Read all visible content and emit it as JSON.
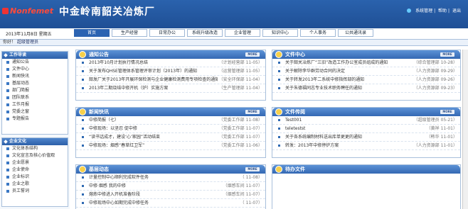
{
  "header": {
    "logo_text": "Nonfemet",
    "company": "中金岭南韶关冶炼厂",
    "links": [
      "系统管理",
      "帮助",
      "退出"
    ]
  },
  "date": "2013年11月8日  星期五",
  "nav": [
    "首页",
    "生产经营",
    "日常办公",
    "系统升级改造",
    "企业管理",
    "知识中心",
    "个人事务",
    "公共通讯录"
  ],
  "welcome": {
    "label": "你好！",
    "user": "超级管理员"
  },
  "sidebar": {
    "work": {
      "title": "工作导读",
      "items": [
        "通知公告",
        "文件中心",
        "新闻快讯",
        "基层动态",
        "部门简报",
        "团队联系",
        "工作月报",
        "党委之窗",
        "专题报告"
      ]
    },
    "culture": {
      "title": "企业文化",
      "items": [
        "文化体系结构",
        "文化宣言及核心价值观",
        "企业愿景",
        "企业使命",
        "企业标识",
        "企业之歌",
        "员工誓词"
      ]
    }
  },
  "more_label": "MORE",
  "panels": {
    "notice": {
      "title": "通知公告",
      "rows": [
        {
          "text": "2013年10月计划执行情况总结",
          "meta": "（计划经营部 11-05）"
        },
        {
          "text": "关于发布QHSE管理体系管理评审计划（2013年）的通知",
          "meta": "（运营管理部 11-05）"
        },
        {
          "text": "韶发厂关于2013年开展环保检测与企业健康检测费用专项检查的通知",
          "meta": "（安全环保部 11-04）"
        },
        {
          "text": "2013年二期烧结中修开机（炉）实施方案",
          "meta": "（生产管理部 11-04）"
        }
      ]
    },
    "files": {
      "title": "文件中心",
      "rows": [
        {
          "text": "关于韶关冶炼厂“三旧”改造工作办公室成员组成的通知",
          "meta": "（综合管理部 10-28）"
        },
        {
          "text": "关于解除李华群劳动合同的决定",
          "meta": "（人力资源部 09-29）"
        },
        {
          "text": "关于转发2013年二系统中修指挥部的通知",
          "meta": "（人力资源部 09-26）"
        },
        {
          "text": "关于朱德福同志专业技术职务聘任的通知",
          "meta": "（人力资源部 09-23）"
        }
      ]
    },
    "news": {
      "title": "新闻快讯",
      "rows": [
        {
          "text": "中修简报（七）",
          "meta": "（党委工作部 11-08）"
        },
        {
          "text": "中修现场：以坚忍 促中修",
          "meta": "（党委工作部 11-07）"
        },
        {
          "text": "“读书话成才，建设‘心’家园”活动结束",
          "meta": "（党委工作部 11-07）"
        },
        {
          "text": "中修现场：烟感“春草红卫军”",
          "meta": "（党委工作部 11-06）"
        }
      ]
    },
    "forward": {
      "title": "文件传阅",
      "rows": [
        {
          "text": "Test001",
          "meta": "（超级管理员 05-21）"
        },
        {
          "text": "teletestst",
          "meta": "（黄祥 11-01）"
        },
        {
          "text": "关于各系统编制材料送出库单更更的通知",
          "meta": "（韩华 11-01）"
        },
        {
          "text": "转发：2013年中修停炉方案",
          "meta": "（人力资源部 11-01）"
        }
      ]
    },
    "grassroots": {
      "title": "基层动态",
      "rows": [
        {
          "text": "计量控制中心顺利完成软件任务",
          "meta": "（ 11-08）"
        },
        {
          "text": "中修·烟感 我的中修",
          "meta": "（烟感车间 11-07）"
        },
        {
          "text": "熔炼中修进入开机准备阶段",
          "meta": "（烟感车间 11-07）"
        },
        {
          "text": "中修现场中心如期完成中修任务",
          "meta": "（ 11-07）"
        }
      ]
    },
    "pending": {
      "title": "待办文件"
    }
  }
}
